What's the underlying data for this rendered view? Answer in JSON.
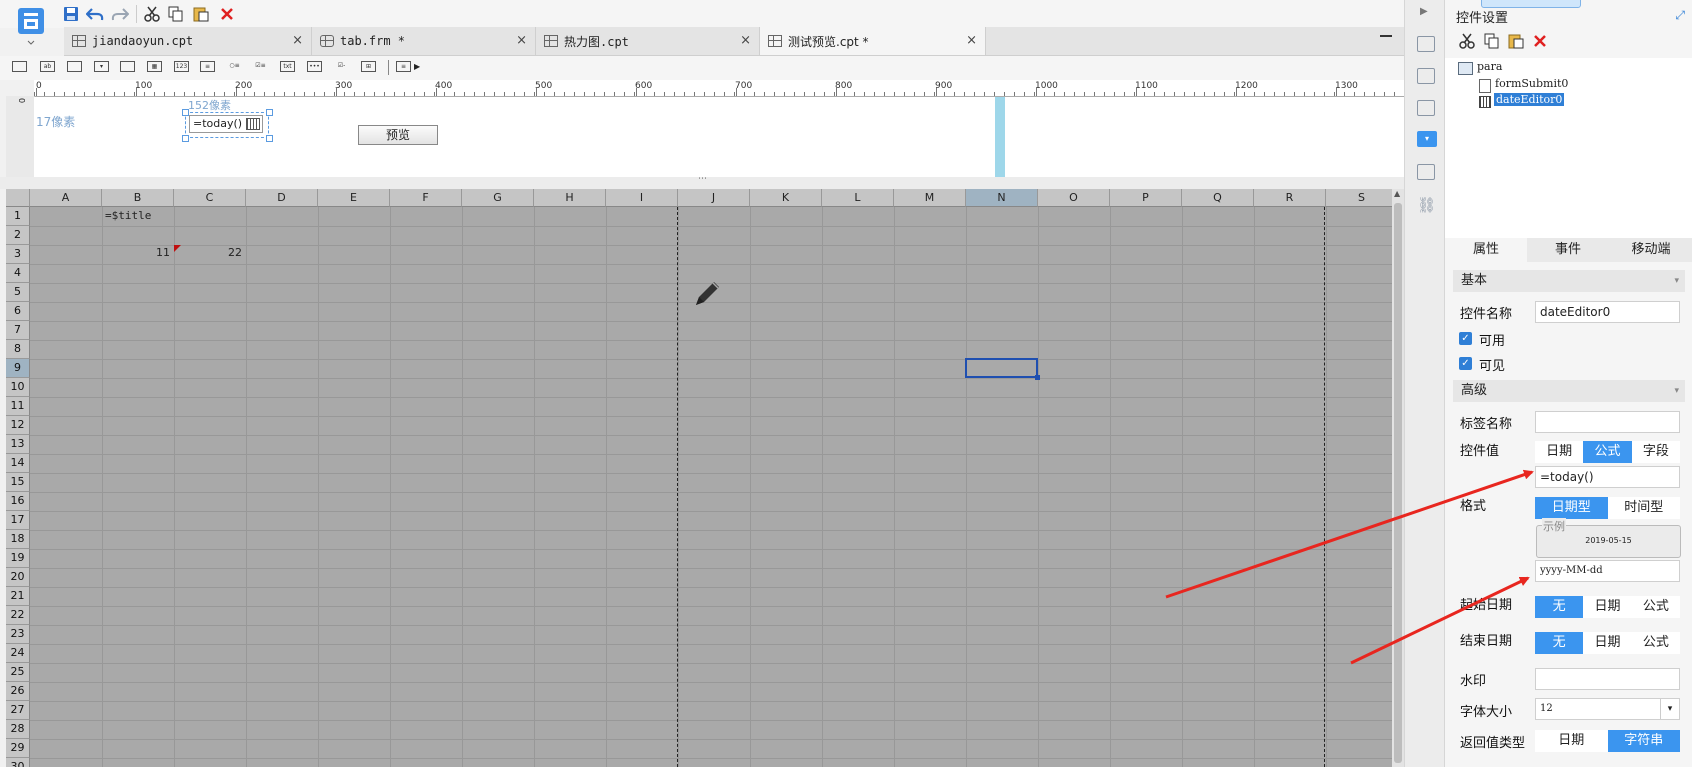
{
  "tabs": [
    {
      "label": "jiandaoyun.cpt"
    },
    {
      "label": "tab.frm *"
    },
    {
      "label": "热力图.cpt"
    },
    {
      "label": "测试预览.cpt *"
    }
  ],
  "tab_close": "×",
  "ruler": [
    "0",
    "100",
    "200",
    "300",
    "400",
    "500",
    "600",
    "700",
    "800",
    "900",
    "1000",
    "1100",
    "1200",
    "1300"
  ],
  "param_pane": {
    "label_17": "17像素",
    "label_152": "152像素",
    "date_editor_value": "=today()",
    "preview_button": "预览",
    "ruler_v": "0"
  },
  "grid": {
    "columns": [
      "A",
      "B",
      "C",
      "D",
      "E",
      "F",
      "G",
      "H",
      "I",
      "J",
      "K",
      "L",
      "M",
      "N",
      "O",
      "P",
      "Q",
      "R",
      "S"
    ],
    "rows": [
      "1",
      "2",
      "3",
      "4",
      "5",
      "6",
      "7",
      "8",
      "9",
      "10",
      "11",
      "12",
      "13",
      "14",
      "15",
      "16",
      "17",
      "18",
      "19",
      "20",
      "21",
      "22",
      "23",
      "24",
      "25",
      "26",
      "27",
      "28",
      "29",
      "30"
    ],
    "selected_column": "N",
    "selected_row": "9",
    "cells": {
      "b1": "=$title",
      "b3": "11",
      "c3": "22"
    }
  },
  "right_panel": {
    "title": "控件设置",
    "tree": {
      "root": "para",
      "children": [
        "formSubmit0",
        "dateEditor0"
      ],
      "selected": "dateEditor0"
    },
    "tabs": [
      "属性",
      "事件",
      "移动端"
    ],
    "active_tab": "属性",
    "section_basic": "基本",
    "widget_name_label": "控件名称",
    "widget_name_value": "dateEditor0",
    "enabled_label": "可用",
    "visible_label": "可见",
    "section_advanced": "高级",
    "tag_name_label": "标签名称",
    "widget_value_label": "控件值",
    "widget_value_options": [
      "日期",
      "公式",
      "字段"
    ],
    "widget_value_selected": "公式",
    "widget_value_formula": "=today()",
    "format_label": "格式",
    "format_options": [
      "日期型",
      "时间型"
    ],
    "format_selected": "日期型",
    "example_legend": "示例",
    "example_value": "2019-05-15",
    "format_pattern": "yyyy-MM-dd",
    "start_date_label": "起始日期",
    "start_date_options": [
      "无",
      "日期",
      "公式"
    ],
    "start_date_selected": "无",
    "end_date_label": "结束日期",
    "end_date_options": [
      "无",
      "日期",
      "公式"
    ],
    "end_date_selected": "无",
    "watermark_label": "水印",
    "font_size_label": "字体大小",
    "font_size_value": "12",
    "return_type_label": "返回值类型",
    "return_type_options": [
      "日期",
      "字符串"
    ],
    "return_type_selected": "字符串"
  },
  "colors": {
    "accent": "#3b95ef",
    "grid_bg": "#a9a9a9",
    "annotation_arrow": "#e8261f",
    "selection": "#1f4fb0"
  }
}
